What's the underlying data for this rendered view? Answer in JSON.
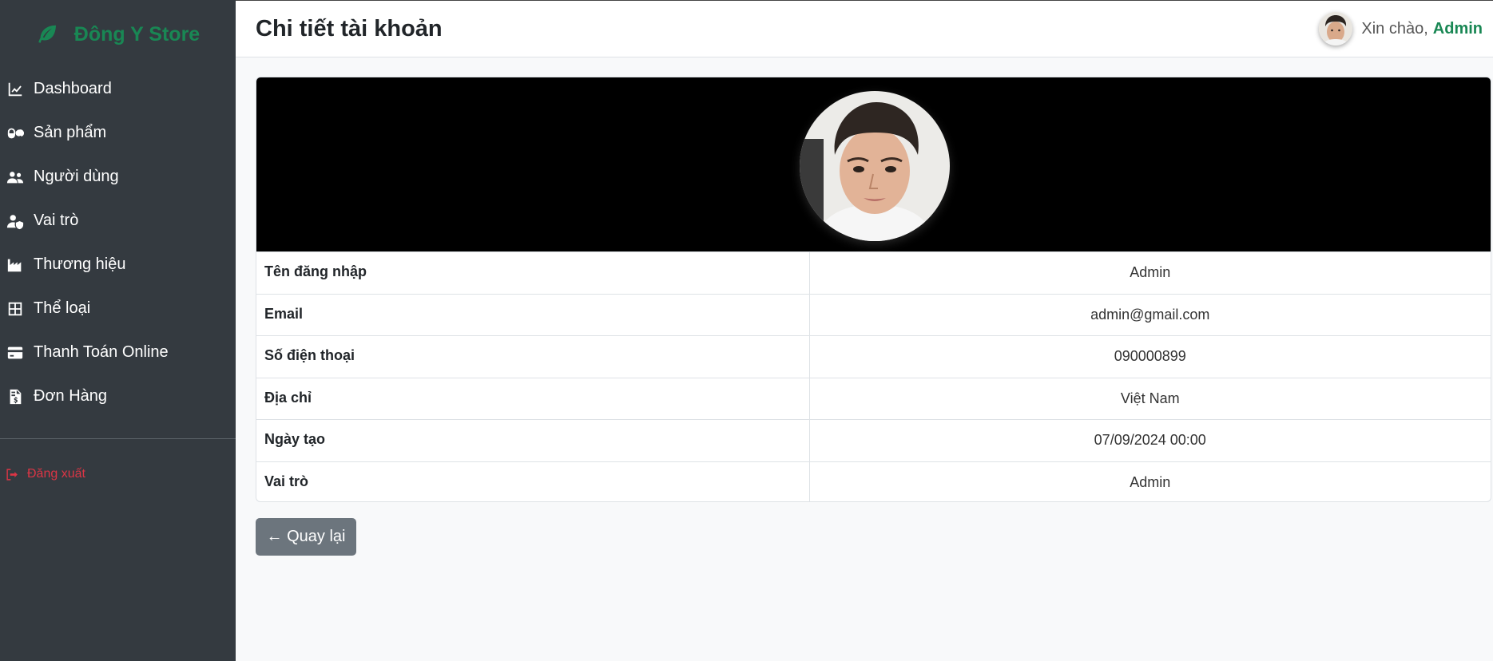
{
  "brand": {
    "name": "Đông Y Store",
    "icon": "leaf-icon",
    "color": "#198754"
  },
  "sidebar": {
    "items": [
      {
        "label": "Dashboard",
        "icon": "chart-line-icon"
      },
      {
        "label": "Sản phẩm",
        "icon": "capsules-icon"
      },
      {
        "label": "Người dùng",
        "icon": "users-icon"
      },
      {
        "label": "Vai trò",
        "icon": "user-shield-icon"
      },
      {
        "label": "Thương hiệu",
        "icon": "industry-icon"
      },
      {
        "label": "Thể loại",
        "icon": "table-grid-icon"
      },
      {
        "label": "Thanh Toán Online",
        "icon": "credit-card-icon"
      },
      {
        "label": "Đơn Hàng",
        "icon": "invoice-icon"
      }
    ],
    "logout_label": "Đăng xuất"
  },
  "header": {
    "title": "Chi tiết tài khoản",
    "greeting": "Xin chào,",
    "user_name": "Admin"
  },
  "details": {
    "rows": [
      {
        "label": "Tên đăng nhập",
        "value": "Admin"
      },
      {
        "label": "Email",
        "value": "admin@gmail.com"
      },
      {
        "label": "Số điện thoại",
        "value": "090000899"
      },
      {
        "label": "Địa chỉ",
        "value": "Việt Nam"
      },
      {
        "label": "Ngày tạo",
        "value": "07/09/2024 00:00"
      },
      {
        "label": "Vai trò",
        "value": "Admin"
      }
    ]
  },
  "back_button": {
    "label": "← Quay lại"
  },
  "colors": {
    "sidebar_bg": "#343a40",
    "accent": "#198754",
    "danger": "#dc3545",
    "secondary": "#6c757d"
  }
}
